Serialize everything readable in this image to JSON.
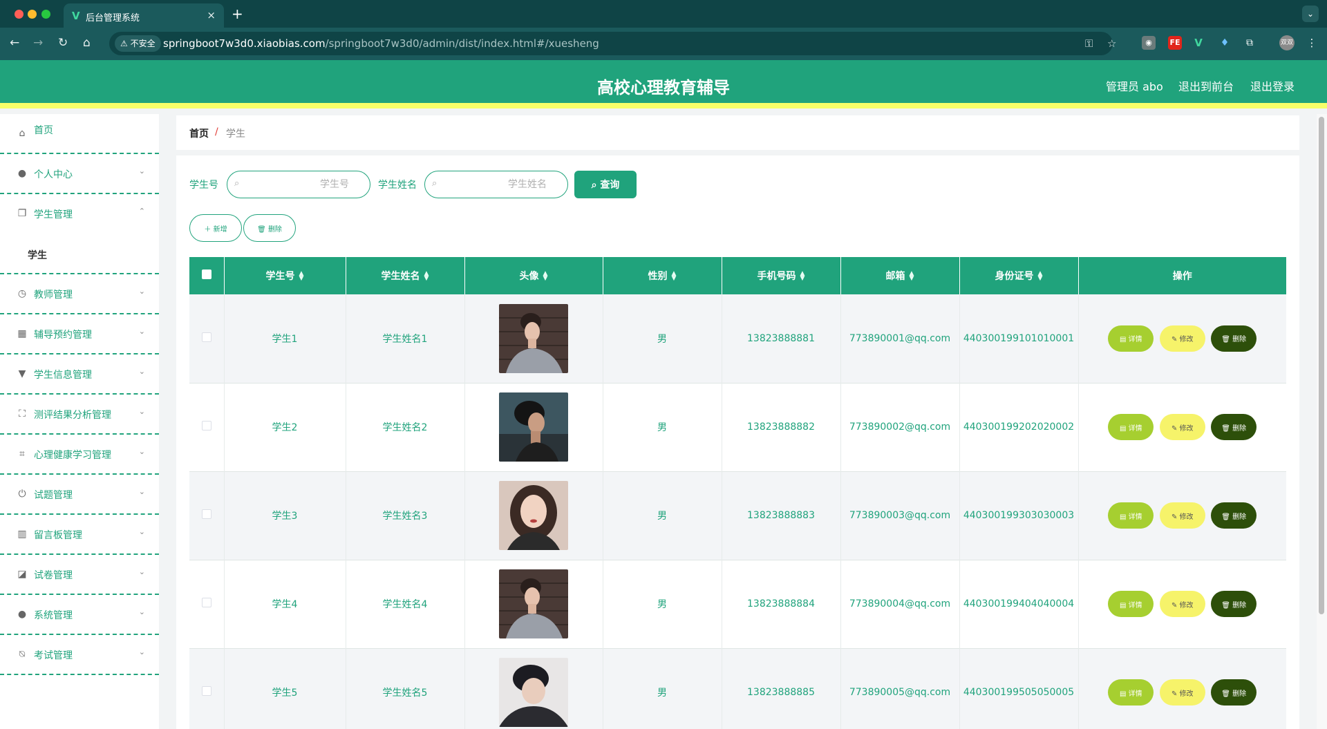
{
  "browser": {
    "tab_title": "后台管理系统",
    "tab_close": "×",
    "new_tab": "+",
    "tab_menu": "⌄",
    "security_label": "不安全",
    "url_host": "springboot7w3d0.xiaobias.com",
    "url_path": "/springboot7w3d0/admin/dist/index.html#/xuesheng",
    "profile_label": "双双"
  },
  "header": {
    "title": "高校心理教育辅导",
    "admin_label": "管理员 abo",
    "front_label": "退出到前台",
    "logout_label": "退出登录"
  },
  "sidebar": {
    "items": [
      {
        "icon": "home-icon",
        "label": "首页"
      },
      {
        "icon": "person-icon",
        "label": "个人中心"
      },
      {
        "icon": "copy-icon",
        "label": "学生管理"
      },
      {
        "icon": "clock-icon",
        "label": "教师管理"
      },
      {
        "icon": "grid-icon",
        "label": "辅导预约管理"
      },
      {
        "icon": "brush-icon",
        "label": "学生信息管理"
      },
      {
        "icon": "fullscreen-icon",
        "label": "测评结果分析管理"
      },
      {
        "icon": "crop-icon",
        "label": "心理健康学习管理"
      },
      {
        "icon": "power-icon",
        "label": "试题管理"
      },
      {
        "icon": "bars-icon",
        "label": "留言板管理"
      },
      {
        "icon": "chart-icon",
        "label": "试卷管理"
      },
      {
        "icon": "user-icon",
        "label": "系统管理"
      },
      {
        "icon": "bell-off-icon",
        "label": "考试管理"
      }
    ],
    "submenu_label": "学生"
  },
  "breadcrumb": {
    "home": "首页",
    "separator": "/",
    "current": "学生"
  },
  "search": {
    "student_id_label": "学生号",
    "student_id_placeholder": "学生号",
    "student_name_label": "学生姓名",
    "student_name_placeholder": "学生姓名",
    "query_label": "查询"
  },
  "toolbar": {
    "add_label": "新增",
    "delete_label": "删除"
  },
  "table": {
    "columns": [
      "学生号",
      "学生姓名",
      "头像",
      "性别",
      "手机号码",
      "邮箱",
      "身份证号",
      "操作"
    ],
    "rows": [
      {
        "id": "学生1",
        "name": "学生姓名1",
        "gender": "男",
        "phone": "13823888881",
        "email": "773890001@qq.com",
        "idcard": "440300199101010001"
      },
      {
        "id": "学生2",
        "name": "学生姓名2",
        "gender": "男",
        "phone": "13823888882",
        "email": "773890002@qq.com",
        "idcard": "440300199202020002"
      },
      {
        "id": "学生3",
        "name": "学生姓名3",
        "gender": "男",
        "phone": "13823888883",
        "email": "773890003@qq.com",
        "idcard": "440300199303030003"
      },
      {
        "id": "学生4",
        "name": "学生姓名4",
        "gender": "男",
        "phone": "13823888884",
        "email": "773890004@qq.com",
        "idcard": "440300199404040004"
      },
      {
        "id": "学生5",
        "name": "学生姓名5",
        "gender": "男",
        "phone": "13823888885",
        "email": "773890005@qq.com",
        "idcard": "440300199505050005"
      }
    ],
    "actions": {
      "detail": "详情",
      "edit": "修改",
      "delete": "删除"
    }
  },
  "colors": {
    "primary": "#20a37c",
    "header_stripe": "#f7ff69",
    "detail": "#a6cf30",
    "edit": "#f6f36a",
    "delete": "#2d4f0a"
  }
}
